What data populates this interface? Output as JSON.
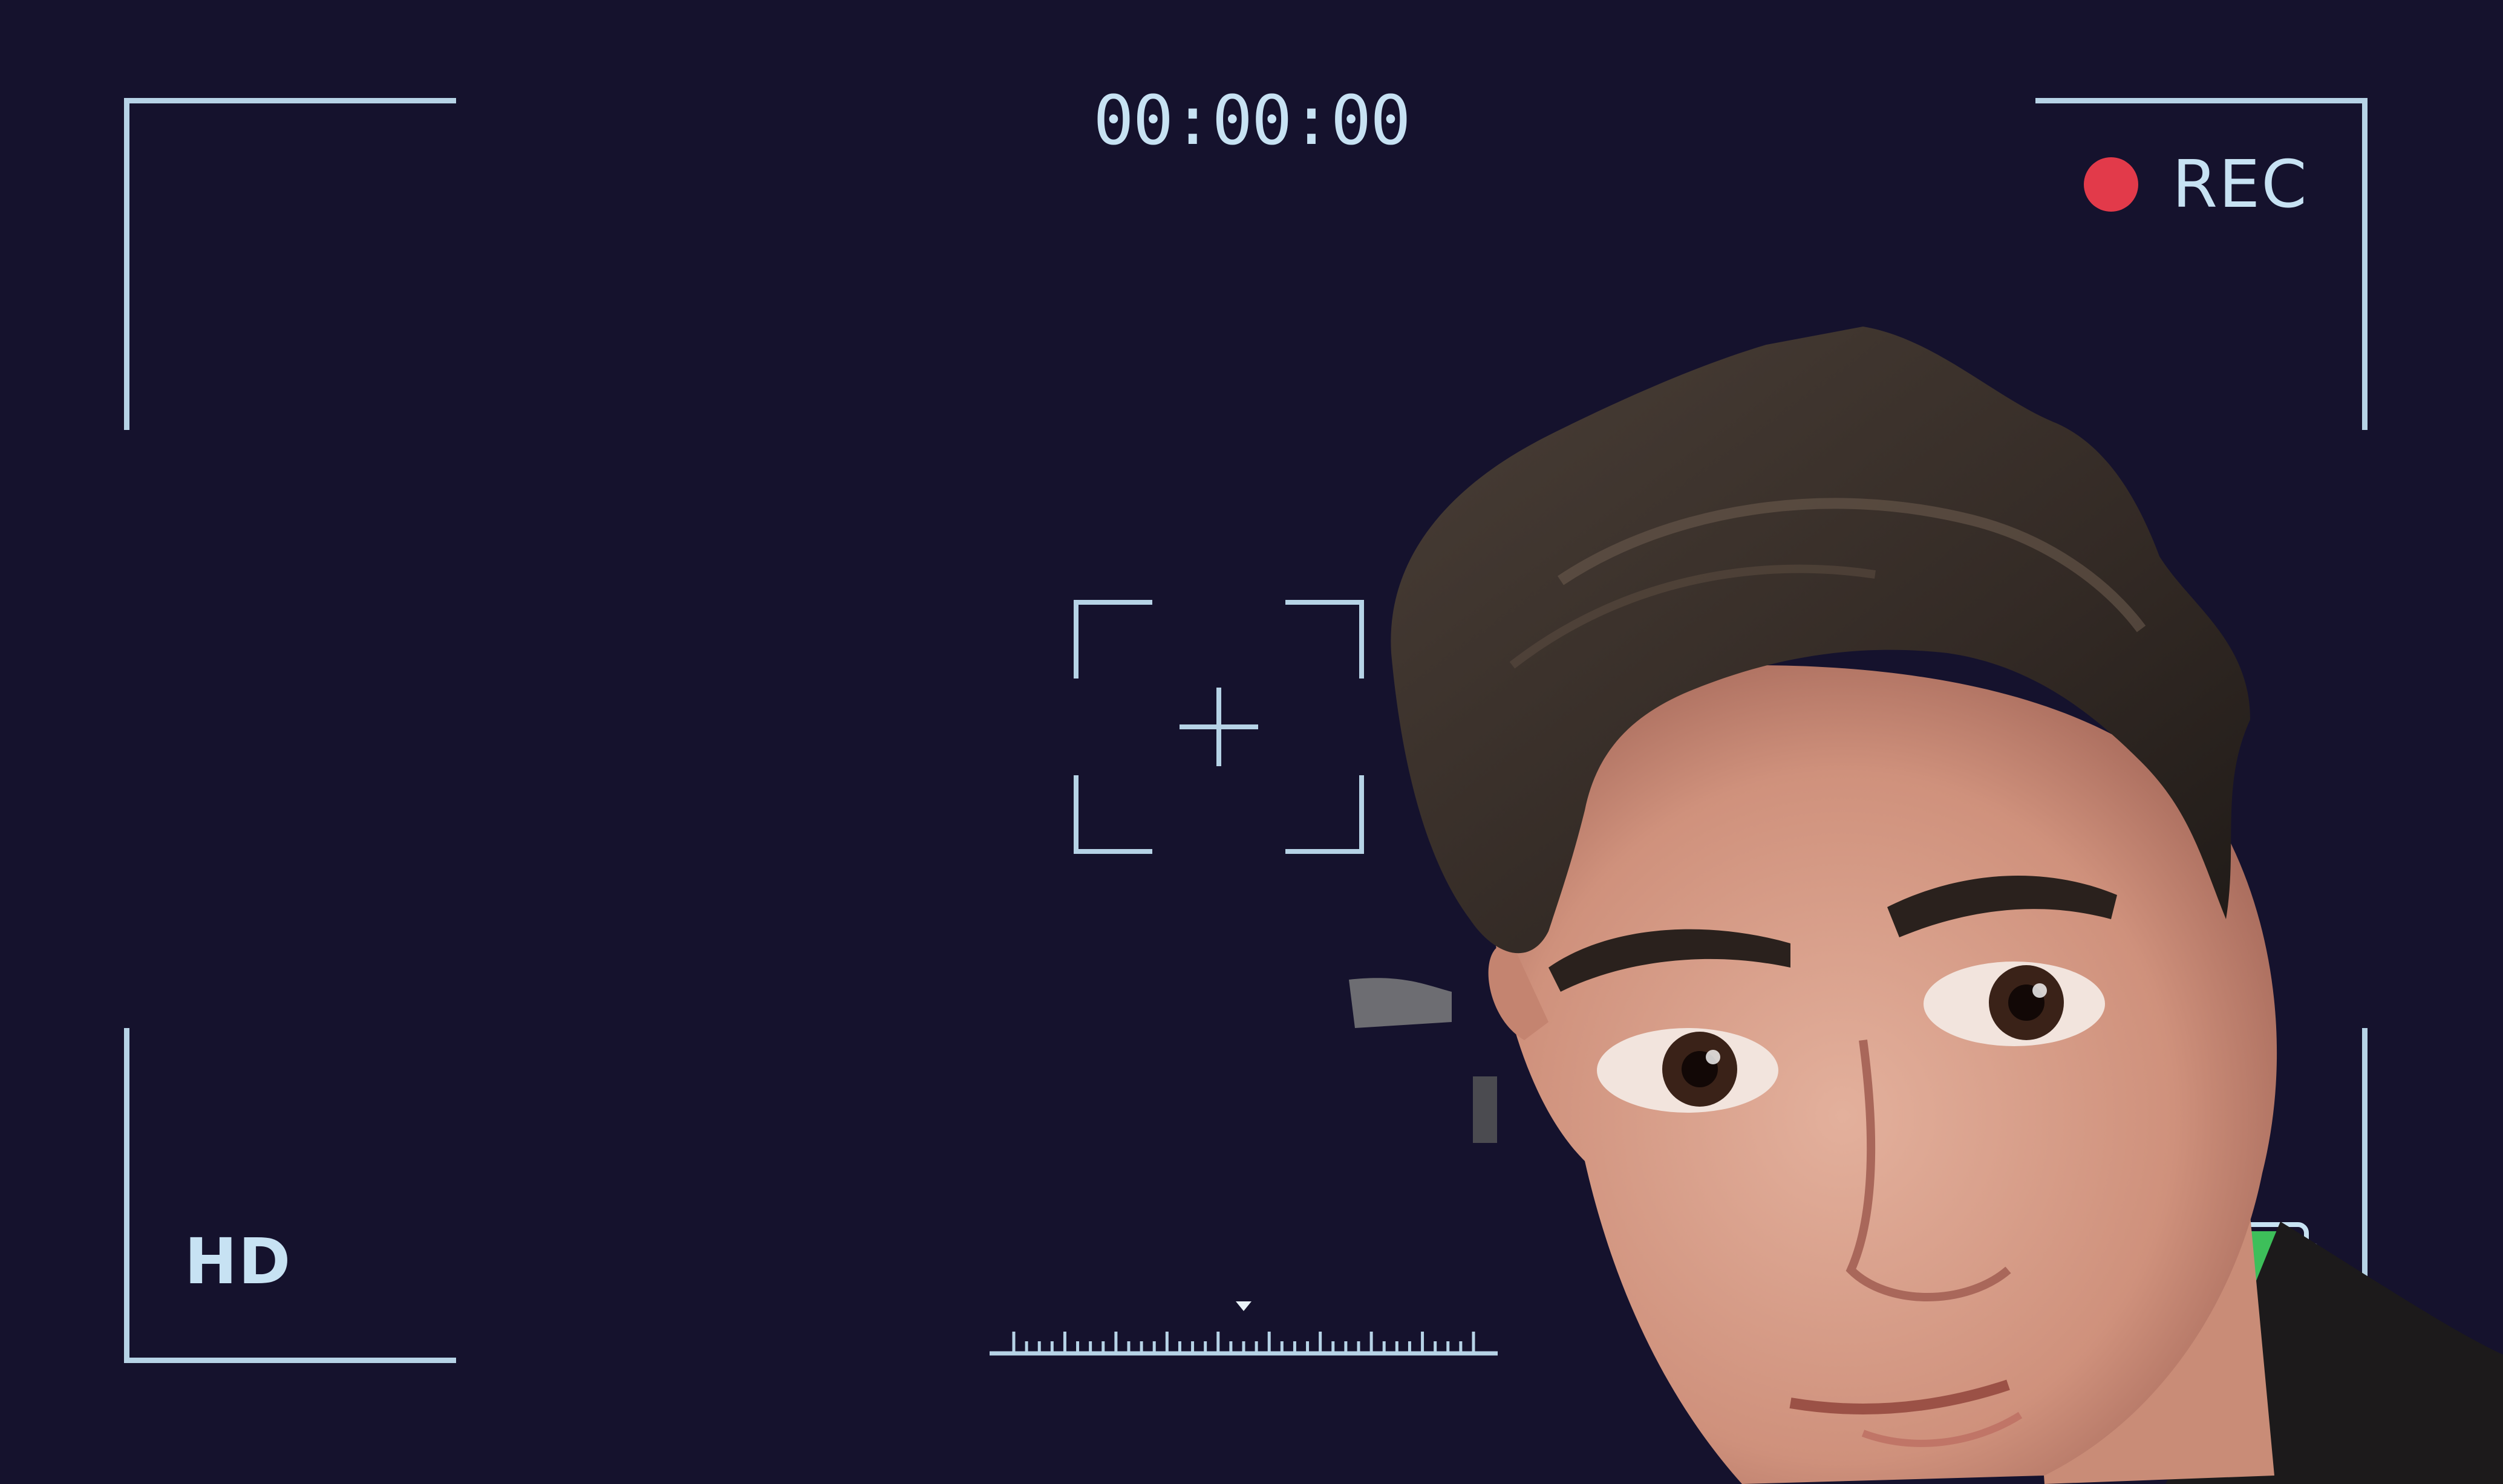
{
  "viewfinder": {
    "timecode": "00:00:00",
    "rec_label": "REC",
    "quality_label": "HD",
    "battery_level": 0.85
  },
  "colors": {
    "background": "#15122d",
    "overlay": "#b6d3e6",
    "text": "#c7e2f3",
    "rec_dot": "#e23a4a",
    "battery_fill": "#3dbf5a"
  },
  "icons": [
    "corner-bracket-icon",
    "rec-dot-icon",
    "focus-crosshair-icon",
    "exposure-ruler-icon",
    "battery-icon"
  ]
}
